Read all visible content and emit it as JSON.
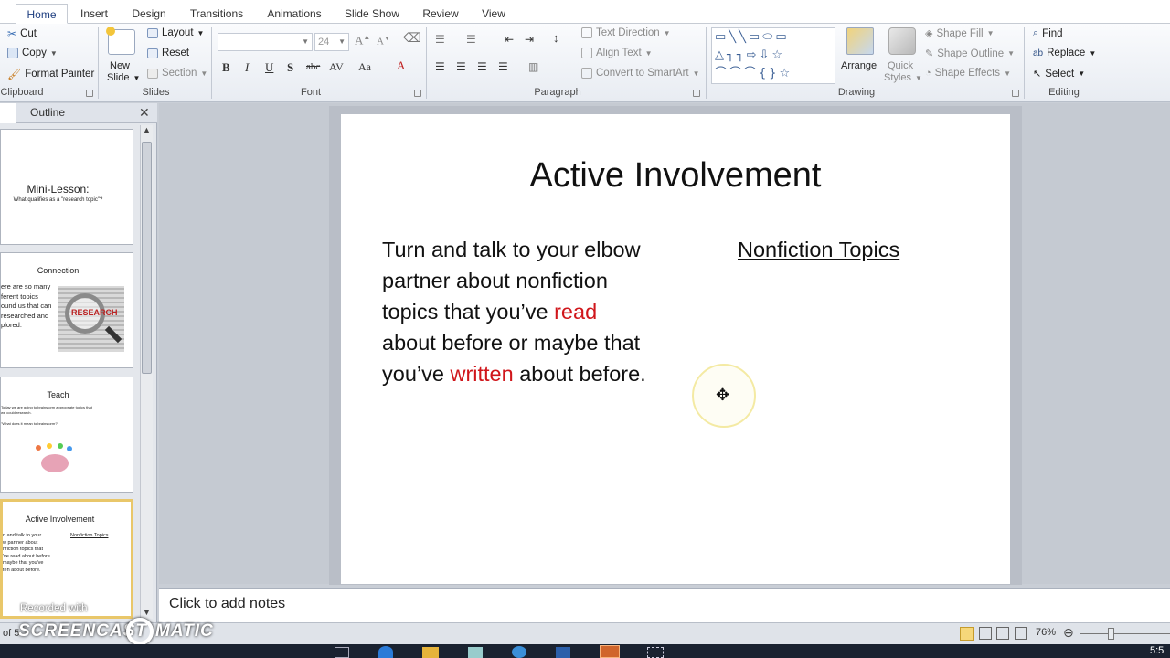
{
  "tabs": [
    {
      "label": "Home"
    },
    {
      "label": "Insert"
    },
    {
      "label": "Design"
    },
    {
      "label": "Transitions"
    },
    {
      "label": "Animations"
    },
    {
      "label": "Slide Show"
    },
    {
      "label": "Review"
    },
    {
      "label": "View"
    }
  ],
  "ribbon": {
    "clipboard": {
      "cut": "Cut",
      "copy": "Copy",
      "format_painter": "Format Painter",
      "label": "Clipboard"
    },
    "slides": {
      "new_slide": "New",
      "new_slide_2": "Slide",
      "layout": "Layout",
      "reset": "Reset",
      "section": "Section",
      "label": "Slides"
    },
    "font": {
      "font_size": "24",
      "label": "Font"
    },
    "paragraph": {
      "text_direction": "Text Direction",
      "align_text": "Align Text",
      "convert_smartart": "Convert to SmartArt",
      "label": "Paragraph"
    },
    "drawing": {
      "arrange": "Arrange",
      "quick": "Quick",
      "styles": "Styles",
      "shape_fill": "Shape Fill",
      "shape_outline": "Shape Outline",
      "shape_effects": "Shape Effects",
      "label": "Drawing"
    },
    "editing": {
      "find": "Find",
      "replace": "Replace",
      "select": "Select",
      "label": "Editing"
    }
  },
  "pane": {
    "tab_outline": "Outline",
    "thumbs": [
      {
        "title": "Mini-Lesson:",
        "subtitle": "What qualifies as a \"research topic\"?"
      },
      {
        "title": "Connection",
        "body": "ere are so many\nferent topics\nound us that can\nresearched and\nplored."
      },
      {
        "title": "Teach",
        "body": "Today we are going to brainstorm appropriate topics that\nwe could research.\n\n\"What does it mean to brainstorm?\""
      },
      {
        "title": "Active Involvement",
        "left": "n and talk to your\nw partner about\nnfiction topics that\n've read about before\nmaybe that you've\nten about before.",
        "right": "Nonfiction Topics"
      }
    ],
    "status_fragment": "of 5"
  },
  "slide": {
    "title": "Active Involvement",
    "body_part1": "Turn and talk to your elbow partner about nonfiction topics that you’ve ",
    "body_red1": "read",
    "body_part2": " about before or maybe that you’ve ",
    "body_red2": "written",
    "body_part3": " about before.",
    "right_heading": "Nonfiction Topics",
    "accent_red": "#d0161b"
  },
  "notes": {
    "placeholder": "Click to add notes"
  },
  "status": {
    "zoom": "76%",
    "clock": "5:5"
  },
  "watermark": {
    "line1": "Recorded with",
    "line2": "SCREENCAST",
    "line3": "MATIC"
  }
}
